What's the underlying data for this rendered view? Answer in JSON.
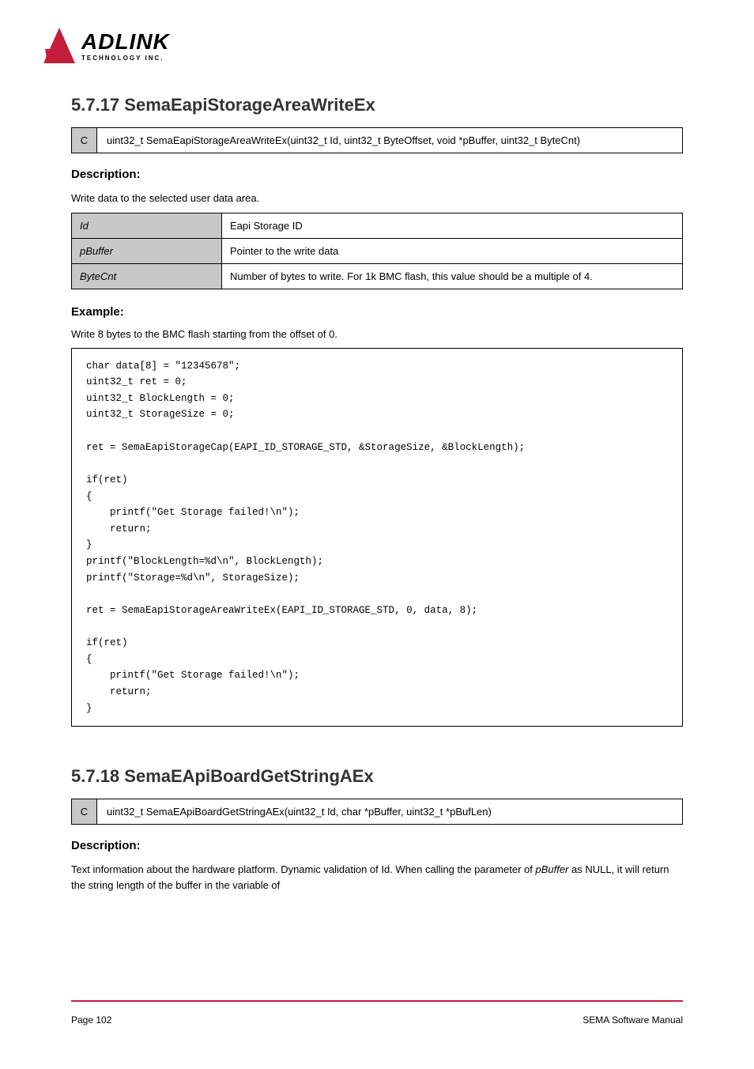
{
  "logo": {
    "main": "ADLINK",
    "sub": "TECHNOLOGY INC."
  },
  "section1": {
    "title": "5.7.17 SemaEapiStorageAreaWriteEx",
    "syntax_label": "C",
    "syntax_content": "uint32_t SemaEapiStorageAreaWriteEx(uint32_t Id, uint32_t ByteOffset, void *pBuffer, uint32_t ByteCnt)",
    "description_heading": "Description:",
    "description_text": "Write data to the selected user data area.",
    "params": [
      {
        "name": "Id",
        "desc": "Eapi Storage ID"
      },
      {
        "name": "pBuffer",
        "desc": "Pointer to the write data"
      },
      {
        "name": "ByteCnt",
        "desc": "Number of bytes to write. For 1k BMC flash, this value should be a multiple of 4."
      }
    ],
    "example_heading": "Example:",
    "example_intro": "Write 8 bytes to the BMC flash starting from the offset of 0.",
    "code": "char data[8] = \"12345678\";\nuint32_t ret = 0;\nuint32_t BlockLength = 0;\nuint32_t StorageSize = 0;\n\nret = SemaEapiStorageCap(EAPI_ID_STORAGE_STD, &StorageSize, &BlockLength);\n\nif(ret)\n{\n    printf(\"Get Storage failed!\\n\");\n    return;\n}\nprintf(\"BlockLength=%d\\n\", BlockLength);\nprintf(\"Storage=%d\\n\", StorageSize);\n\nret = SemaEapiStorageAreaWriteEx(EAPI_ID_STORAGE_STD, 0, data, 8);\n\nif(ret)\n{\n    printf(\"Get Storage failed!\\n\");\n    return;\n}"
  },
  "section2": {
    "title": "5.7.18 SemaEApiBoardGetStringAEx",
    "syntax_label": "C",
    "syntax_content": "uint32_t SemaEApiBoardGetStringAEx(uint32_t Id, char *pBuffer, uint32_t *pBufLen)",
    "description_heading": "Description:",
    "description_text": "Text information about the hardware platform. Dynamic validation of Id. When calling the parameter of ",
    "description_text_italic": "pBuffer",
    "description_text_after": " as NULL, it will return the string length of the buffer in the variable of "
  },
  "footer": {
    "page": "Page 102",
    "title": "SEMA Software Manual"
  }
}
